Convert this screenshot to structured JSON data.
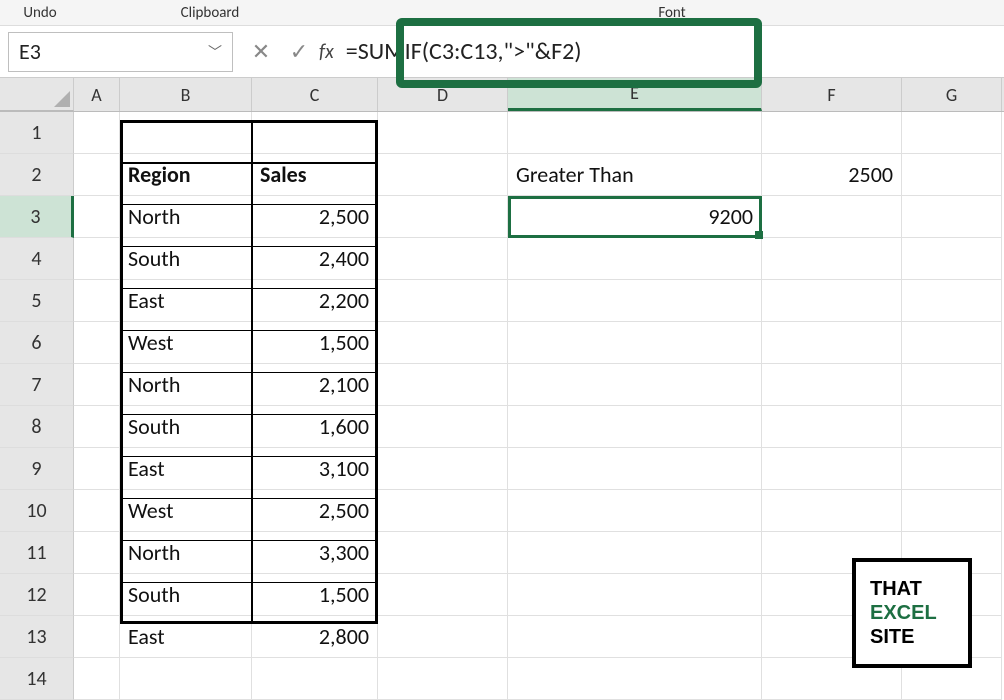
{
  "ribbon": {
    "undo": "Undo",
    "clipboard": "Clipboard",
    "font": "Font"
  },
  "nameBox": "E3",
  "formula": "=SUMIF(C3:C13,\">\"&F2)",
  "columns": [
    "A",
    "B",
    "C",
    "D",
    "E",
    "F",
    "G"
  ],
  "rowNums": [
    "1",
    "2",
    "3",
    "4",
    "5",
    "6",
    "7",
    "8",
    "9",
    "10",
    "11",
    "12",
    "13",
    "14"
  ],
  "headers": {
    "region": "Region",
    "sales": "Sales"
  },
  "table": [
    {
      "region": "North",
      "sales": "2,500"
    },
    {
      "region": "South",
      "sales": "2,400"
    },
    {
      "region": "East",
      "sales": "2,200"
    },
    {
      "region": "West",
      "sales": "1,500"
    },
    {
      "region": "North",
      "sales": "2,100"
    },
    {
      "region": "South",
      "sales": "1,600"
    },
    {
      "region": "East",
      "sales": "3,100"
    },
    {
      "region": "West",
      "sales": "2,500"
    },
    {
      "region": "North",
      "sales": "3,300"
    },
    {
      "region": "South",
      "sales": "1,500"
    },
    {
      "region": "East",
      "sales": "2,800"
    }
  ],
  "side": {
    "label": "Greater Than",
    "threshold": "2500",
    "result": "9200"
  },
  "logo": {
    "l1": "THAT",
    "l2": "EXCEL",
    "l3": "SITE"
  }
}
